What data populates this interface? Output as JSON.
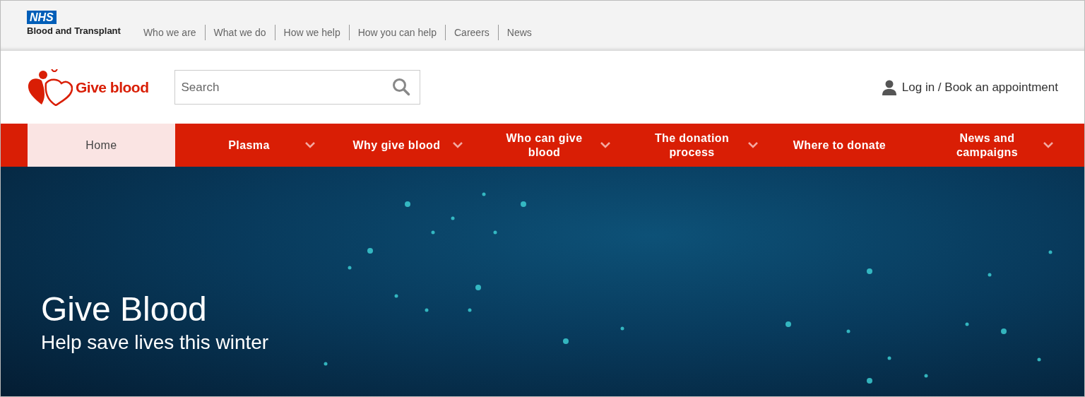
{
  "brand": {
    "badge": "NHS",
    "name": "Blood and Transplant"
  },
  "top_links": [
    "Who we are",
    "What we do",
    "How we help",
    "How you can help",
    "Careers",
    "News"
  ],
  "logo": {
    "text": "Give blood"
  },
  "search": {
    "placeholder": "Search"
  },
  "account_link": "Log in / Book an appointment",
  "nav": [
    {
      "label": "Home",
      "selected": true,
      "has_menu": false
    },
    {
      "label": "Plasma",
      "selected": false,
      "has_menu": true
    },
    {
      "label": "Why give blood",
      "selected": false,
      "has_menu": true
    },
    {
      "label": "Who can give blood",
      "selected": false,
      "has_menu": true
    },
    {
      "label": "The donation process",
      "selected": false,
      "has_menu": true
    },
    {
      "label": "Where to donate",
      "selected": false,
      "has_menu": false
    },
    {
      "label": "News and campaigns",
      "selected": false,
      "has_menu": true
    }
  ],
  "hero": {
    "title": "Give Blood",
    "subtitle": "Help save lives this winter"
  }
}
